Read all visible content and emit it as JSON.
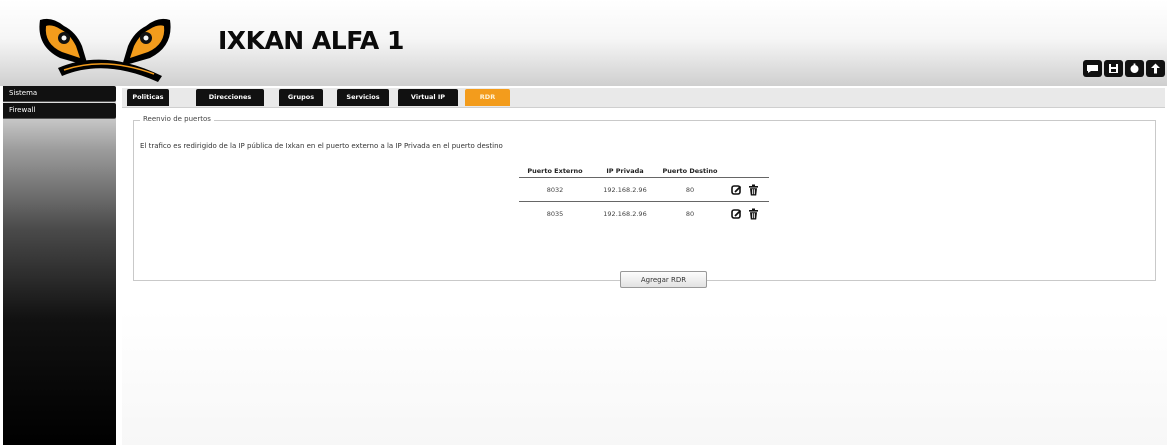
{
  "app": {
    "title": "IXKAN ALFA 1",
    "logo_text": "IXKAN",
    "accent_color": "#f39c1c"
  },
  "toolbar": {
    "icons": [
      "chat-icon",
      "save-icon",
      "power-icon",
      "upload-icon"
    ]
  },
  "sidebar": {
    "items": [
      {
        "label": "Sistema"
      },
      {
        "label": "Firewall"
      }
    ]
  },
  "tabs": [
    {
      "label": "Politicas",
      "active": false
    },
    {
      "label": "Direcciones",
      "active": false
    },
    {
      "label": "Grupos",
      "active": false
    },
    {
      "label": "Servicios",
      "active": false
    },
    {
      "label": "Virtual IP",
      "active": false
    },
    {
      "label": "RDR",
      "active": true
    }
  ],
  "panel": {
    "legend": "Reenvio de puertos",
    "description": "El trafico es redirigido de la IP pública de Ixkan en el puerto externo a la IP Privada en el puerto destino",
    "table": {
      "headers": [
        "Puerto Externo",
        "IP Privada",
        "Puerto Destino"
      ],
      "rows": [
        {
          "puerto_externo": "8032",
          "ip_privada": "192.168.2.96",
          "puerto_destino": "80"
        },
        {
          "puerto_externo": "8035",
          "ip_privada": "192.168.2.96",
          "puerto_destino": "80"
        }
      ],
      "row_icons": [
        "edit-icon",
        "trash-icon"
      ]
    },
    "add_button": "Agregar RDR"
  }
}
